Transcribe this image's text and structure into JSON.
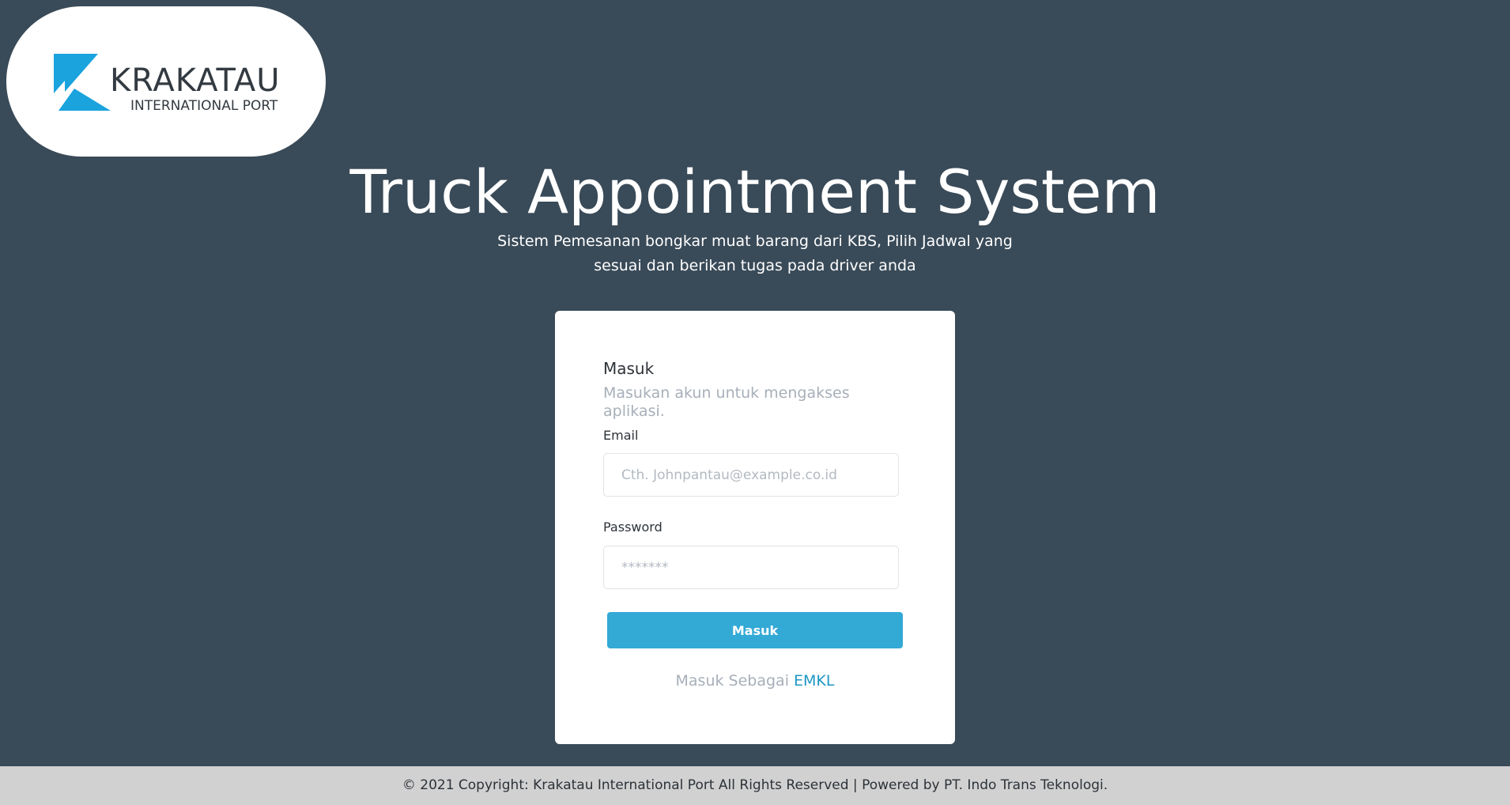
{
  "brand": {
    "logo_wordmark": "KRAKATAU",
    "logo_subtitle": "INTERNATIONAL PORT",
    "logo_color": "#1aa3dd"
  },
  "hero": {
    "title": "Truck Appointment System",
    "subtitle": "Sistem Pemesanan bongkar muat barang dari KBS, Pilih Jadwal yang sesuai dan berikan tugas pada driver anda"
  },
  "login_card": {
    "title": "Masuk",
    "description": "Masukan akun untuk mengakses aplikasi.",
    "email_label": "Email",
    "email_placeholder": "Cth. Johnpantau@example.co.id",
    "email_value": "",
    "password_label": "Password",
    "password_placeholder": "*******",
    "password_value": "",
    "submit_label": "Masuk",
    "alt_prefix": "Masuk Sebagai",
    "alt_link": "EMKL"
  },
  "footer": {
    "text": "© 2021 Copyright: Krakatau International Port All Rights Reserved | Powered by PT. Indo Trans Teknologi."
  },
  "colors": {
    "background": "#394a58",
    "card": "#ffffff",
    "button": "#33a9d6",
    "link": "#1b97c4",
    "footer": "#d1d1d1"
  }
}
